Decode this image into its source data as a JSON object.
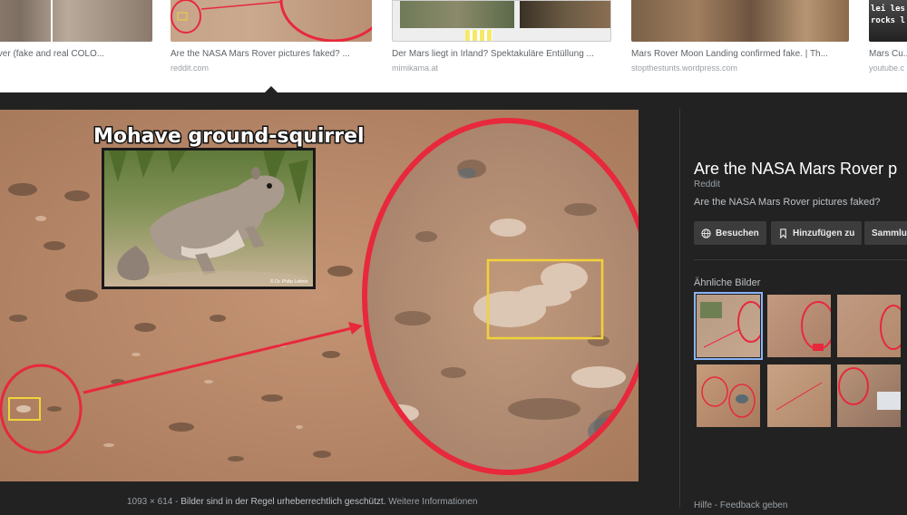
{
  "results": [
    {
      "title": "Mars Rover (fake and real COLO...",
      "source": ""
    },
    {
      "title": "Are the NASA Mars Rover pictures faked? ...",
      "source": "reddit.com"
    },
    {
      "title": "Der Mars liegt in Irland? Spektakuläre Entüllung ...",
      "source": "mimikama.at"
    },
    {
      "title": "Mars Rover Moon Landing confirmed fake. | Th...",
      "source": "stopthestunts.wordpress.com"
    },
    {
      "title": "Mars Cu...",
      "source": "youtube.c"
    }
  ],
  "thumb_overlay_text": "lei les rocks l",
  "preview": {
    "annotation_label": "Mohave ground-squirrel",
    "photo_credit": "© Dr. Philip Leitner",
    "dimensions": "1093 × 614",
    "copyright_note": "Bilder sind in der Regel urheberrechtlich geschützt.",
    "more_info": "Weitere Informationen",
    "separator": " - "
  },
  "side": {
    "title": "Are the NASA Mars Rover p",
    "source": "Reddit",
    "description": "Are the NASA Mars Rover pictures faked?",
    "visit_label": "Besuchen",
    "save_label": "Hinzufügen zu",
    "collection_label": "Sammlun",
    "similar_heading": "Ähnliche Bilder"
  },
  "footer": {
    "help": "Hilfe",
    "separator": " - ",
    "feedback": "Feedback geben"
  },
  "colors": {
    "panel_bg": "#222222",
    "annotation_red": "#e8283c",
    "highlight_yellow": "#f2d23a",
    "mars_sand": "#b98a6a"
  }
}
